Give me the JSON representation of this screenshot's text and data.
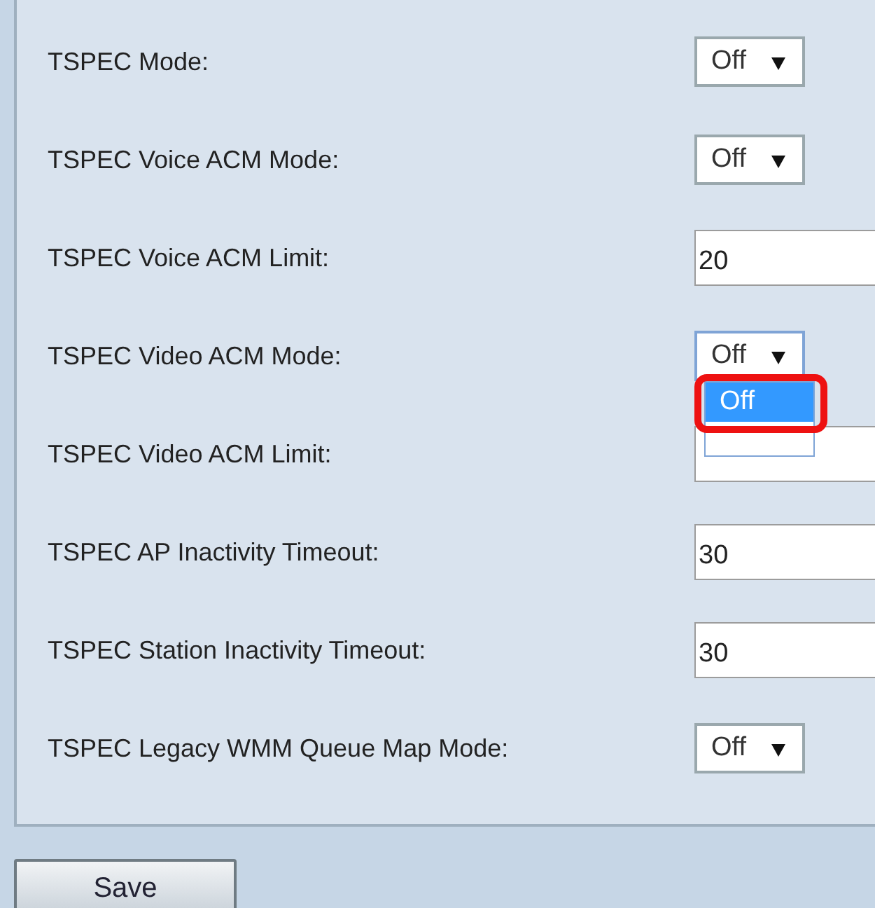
{
  "settings": [
    {
      "label": "TSPEC Mode:",
      "kind": "select",
      "value": "Off"
    },
    {
      "label": "TSPEC Voice ACM Mode:",
      "kind": "select",
      "value": "Off"
    },
    {
      "label": "TSPEC Voice ACM Limit:",
      "kind": "input",
      "value": "20"
    },
    {
      "label": "TSPEC Video ACM Mode:",
      "kind": "select",
      "value": "Off",
      "expanded": true,
      "options": [
        {
          "label": "Off",
          "selected": true,
          "highlighted": true
        }
      ]
    },
    {
      "label": "TSPEC Video ACM Limit:",
      "kind": "input"
    },
    {
      "label": "TSPEC AP Inactivity Timeout:",
      "kind": "input",
      "value": "30"
    },
    {
      "label": "TSPEC Station Inactivity Timeout:",
      "kind": "input",
      "value": "30"
    },
    {
      "label": "TSPEC Legacy WMM Queue Map Mode:",
      "kind": "select",
      "value": "Off"
    }
  ],
  "save_button": "Save"
}
